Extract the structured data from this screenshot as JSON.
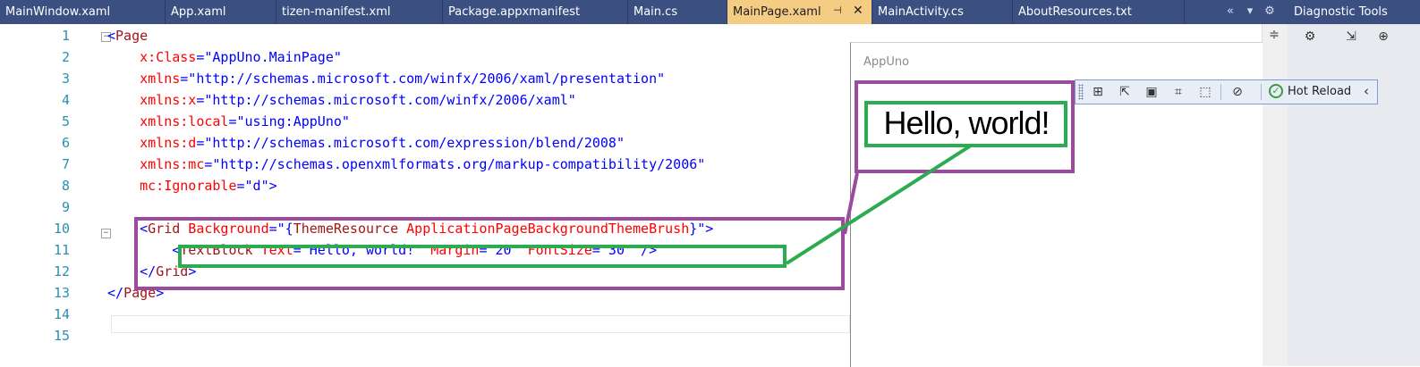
{
  "tabs": [
    {
      "label": "MainWindow.xaml"
    },
    {
      "label": "App.xaml"
    },
    {
      "label": "tizen-manifest.xml"
    },
    {
      "label": "Package.appxmanifest"
    },
    {
      "label": "Main.cs"
    },
    {
      "label": "MainPage.xaml",
      "active": true
    },
    {
      "label": "MainActivity.cs"
    },
    {
      "label": "AboutResources.txt"
    }
  ],
  "tab_controls": {
    "overflow_icon": "chevrons-left-icon",
    "dropdown_icon": "dropdown-icon",
    "settings_icon": "gear-icon"
  },
  "active_tab_pin_icon": "pin-icon",
  "active_tab_close_icon": "close-icon",
  "diagnostic_tools": {
    "title": "Diagnostic Tools"
  },
  "editor": {
    "line_numbers": [
      "1",
      "2",
      "3",
      "4",
      "5",
      "6",
      "7",
      "8",
      "9",
      "10",
      "11",
      "12",
      "13",
      "14",
      "15"
    ],
    "lines": [
      {
        "n": 1,
        "parts": [
          {
            "t": "<",
            "c": "blue"
          },
          {
            "t": "Page",
            "c": "maroon"
          }
        ]
      },
      {
        "n": 2,
        "parts": [
          {
            "t": "    x:Class",
            "c": "red"
          },
          {
            "t": "=\"",
            "c": "blue"
          },
          {
            "t": "AppUno.MainPage",
            "c": "blue"
          },
          {
            "t": "\"",
            "c": "blue"
          }
        ]
      },
      {
        "n": 3,
        "parts": [
          {
            "t": "    xmlns",
            "c": "red"
          },
          {
            "t": "=\"http://schemas.microsoft.com/winfx/2006/xaml/presentation\"",
            "c": "blue"
          }
        ]
      },
      {
        "n": 4,
        "parts": [
          {
            "t": "    xmlns:x",
            "c": "red"
          },
          {
            "t": "=\"http://schemas.microsoft.com/winfx/2006/xaml\"",
            "c": "blue"
          }
        ]
      },
      {
        "n": 5,
        "parts": [
          {
            "t": "    xmlns:local",
            "c": "red"
          },
          {
            "t": "=\"using:AppUno\"",
            "c": "blue"
          }
        ]
      },
      {
        "n": 6,
        "parts": [
          {
            "t": "    xmlns:d",
            "c": "red"
          },
          {
            "t": "=\"http://schemas.microsoft.com/expression/blend/2008\"",
            "c": "blue"
          }
        ]
      },
      {
        "n": 7,
        "parts": [
          {
            "t": "    xmlns:mc",
            "c": "red"
          },
          {
            "t": "=\"http://schemas.openxmlformats.org/markup-compatibility/2006\"",
            "c": "blue"
          }
        ]
      },
      {
        "n": 8,
        "parts": [
          {
            "t": "    mc:Ignorable",
            "c": "red"
          },
          {
            "t": "=\"d\">",
            "c": "blue"
          }
        ]
      },
      {
        "n": 9,
        "parts": []
      },
      {
        "n": 10,
        "parts": [
          {
            "t": "    <",
            "c": "blue"
          },
          {
            "t": "Grid",
            "c": "maroon"
          },
          {
            "t": " Background",
            "c": "red"
          },
          {
            "t": "=\"{",
            "c": "blue"
          },
          {
            "t": "ThemeResource",
            "c": "maroon"
          },
          {
            "t": " ApplicationPageBackgroundThemeBrush",
            "c": "red"
          },
          {
            "t": "}\">",
            "c": "blue"
          }
        ]
      },
      {
        "n": 11,
        "parts": [
          {
            "t": "        <",
            "c": "blue"
          },
          {
            "t": "TextBlock",
            "c": "maroon"
          },
          {
            "t": " Text",
            "c": "red"
          },
          {
            "t": "=\"Hello, world!\"",
            "c": "blue"
          },
          {
            "t": " Margin",
            "c": "red"
          },
          {
            "t": "=\"20\"",
            "c": "blue"
          },
          {
            "t": " FontSize",
            "c": "red"
          },
          {
            "t": "=\"30\"",
            "c": "blue"
          },
          {
            "t": " />",
            "c": "blue"
          }
        ]
      },
      {
        "n": 12,
        "parts": [
          {
            "t": "    </",
            "c": "blue"
          },
          {
            "t": "Grid",
            "c": "maroon"
          },
          {
            "t": ">",
            "c": "blue"
          }
        ]
      },
      {
        "n": 13,
        "parts": [
          {
            "t": "</",
            "c": "blue"
          },
          {
            "t": "Page",
            "c": "maroon"
          },
          {
            "t": ">",
            "c": "blue"
          }
        ]
      },
      {
        "n": 14,
        "parts": []
      },
      {
        "n": 15,
        "parts": []
      }
    ]
  },
  "app_preview": {
    "window_title": "AppUno",
    "text": "Hello, world!"
  },
  "hot_reload_toolbar": {
    "buttons": [
      {
        "icon": "live-visual-tree-icon"
      },
      {
        "icon": "select-element-icon"
      },
      {
        "icon": "display-layout-adorners-icon"
      },
      {
        "icon": "track-focus-icon"
      },
      {
        "icon": "preview-selection-icon"
      },
      {
        "icon": "xaml-binding-failures-icon"
      }
    ],
    "hot_reload_label": "Hot Reload",
    "collapse_icon": "chevron-left-icon"
  },
  "colors": {
    "tab_bar": "#3b4f81",
    "active_tab": "#f5cc84",
    "annotation_outer": "#9b4a9e",
    "annotation_inner": "#2bac50"
  }
}
